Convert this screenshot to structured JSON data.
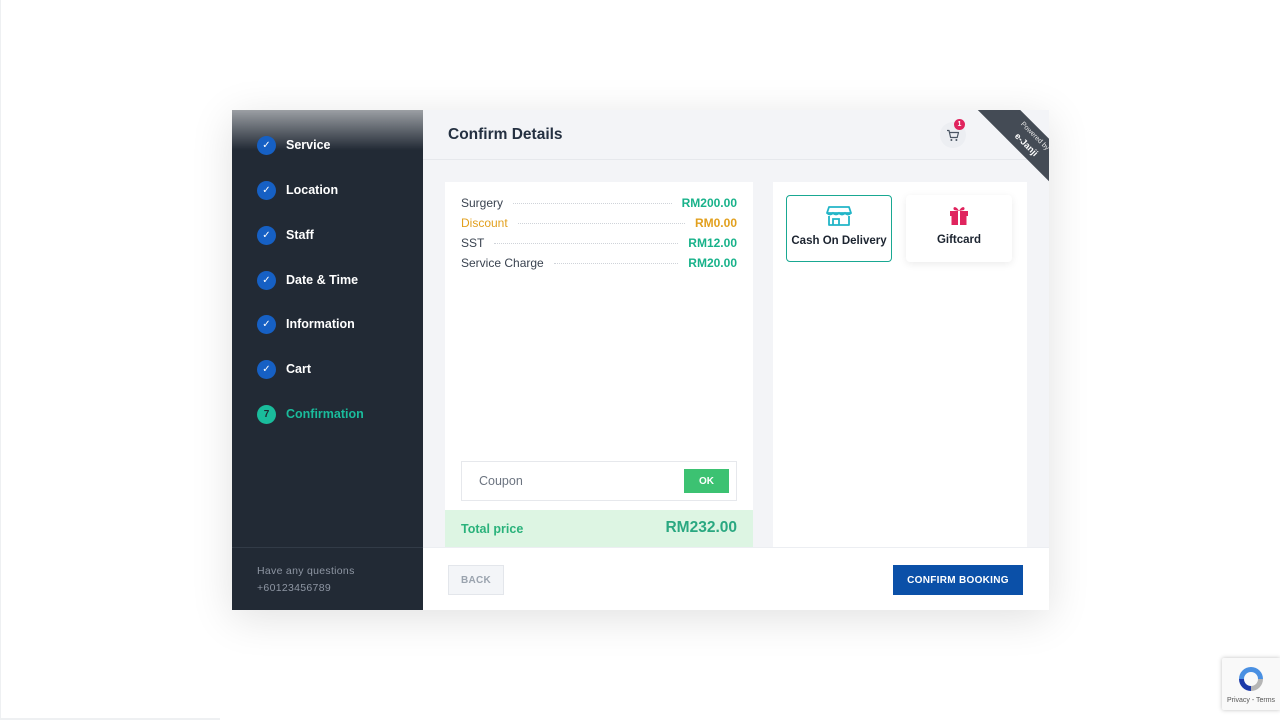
{
  "sidebar": {
    "steps": [
      {
        "label": "Service",
        "badge": "✓"
      },
      {
        "label": "Location",
        "badge": "✓"
      },
      {
        "label": "Staff",
        "badge": "✓"
      },
      {
        "label": "Date & Time",
        "badge": "✓"
      },
      {
        "label": "Information",
        "badge": "✓"
      },
      {
        "label": "Cart",
        "badge": "✓"
      },
      {
        "label": "Confirmation",
        "badge": "7",
        "active": true
      }
    ],
    "footer": {
      "question": "Have any questions",
      "phone": "+60123456789"
    }
  },
  "header": {
    "title": "Confirm Details",
    "cart_count": "1",
    "cart_icon": "cart-icon",
    "ribbon_line1": "Powered by",
    "ribbon_line2": "e-Janji"
  },
  "summary": {
    "items": [
      {
        "name": "Surgery",
        "amount": "RM200.00"
      },
      {
        "name": "Discount",
        "amount": "RM0.00",
        "type": "discount"
      },
      {
        "name": "SST",
        "amount": "RM12.00"
      },
      {
        "name": "Service Charge",
        "amount": "RM20.00"
      }
    ],
    "coupon_placeholder": "Coupon",
    "coupon_button": "OK",
    "total_label": "Total price",
    "total_value": "RM232.00"
  },
  "payment": {
    "options": [
      {
        "label": "Cash On Delivery",
        "icon": "store-icon",
        "selected": true
      },
      {
        "label": "Giftcard",
        "icon": "gift-icon",
        "selected": false
      }
    ]
  },
  "footer": {
    "back_label": "BACK",
    "confirm_label": "CONFIRM BOOKING"
  },
  "recaptcha": {
    "terms": "Privacy - Terms"
  },
  "colors": {
    "sidebar_bg": "#222a35",
    "step_badge": "#1660c4",
    "active_accent": "#1abc9c",
    "amount_green": "#18b28a",
    "discount_orange": "#e2a01e",
    "ok_green": "#3cc272",
    "confirm_blue": "#0b50a8",
    "total_bar": "#ddf5e3"
  }
}
